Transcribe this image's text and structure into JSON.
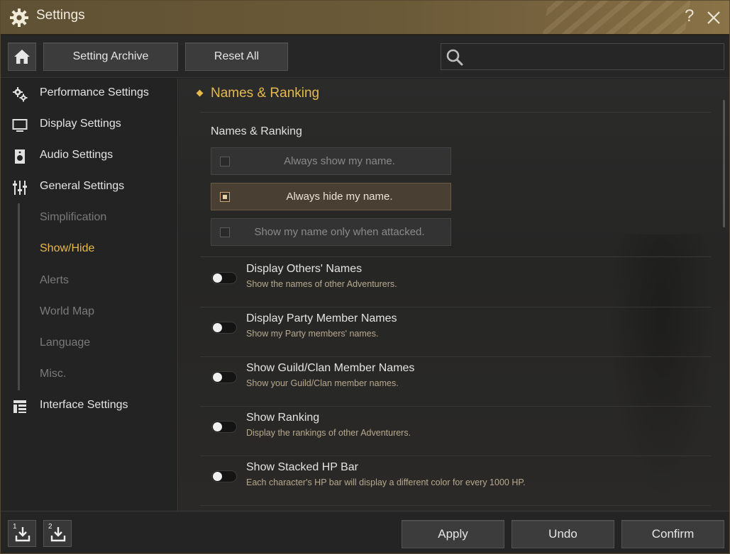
{
  "window": {
    "title": "Settings",
    "help_glyph": "?",
    "close_glyph": "close"
  },
  "toolbar": {
    "archive_label": "Setting Archive",
    "reset_label": "Reset All",
    "search_value": "",
    "search_placeholder": ""
  },
  "sidebar": {
    "items": [
      {
        "label": "Performance Settings",
        "icon": "gears-icon"
      },
      {
        "label": "Display Settings",
        "icon": "monitor-icon"
      },
      {
        "label": "Audio Settings",
        "icon": "speaker-icon"
      },
      {
        "label": "General Settings",
        "icon": "sliders-icon"
      },
      {
        "label": "Interface Settings",
        "icon": "layout-icon"
      }
    ],
    "sub_items": [
      {
        "label": "Simplification",
        "active": false
      },
      {
        "label": "Show/Hide",
        "active": true
      },
      {
        "label": "Alerts",
        "active": false
      },
      {
        "label": "World Map",
        "active": false
      },
      {
        "label": "Language",
        "active": false
      },
      {
        "label": "Misc.",
        "active": false
      }
    ]
  },
  "main": {
    "section_title": "Names & Ranking",
    "group_label": "Names & Ranking",
    "name_options": [
      {
        "label": "Always show my name.",
        "selected": false
      },
      {
        "label": "Always hide my name.",
        "selected": true
      },
      {
        "label": "Show my name only when attacked.",
        "selected": false
      }
    ],
    "toggles": [
      {
        "title": "Display Others' Names",
        "desc": "Show the names of other Adventurers.",
        "on": false
      },
      {
        "title": "Display Party Member Names",
        "desc": "Show my Party members' names.",
        "on": false
      },
      {
        "title": "Show Guild/Clan Member Names",
        "desc": "Show your Guild/Clan member names.",
        "on": false
      },
      {
        "title": "Show Ranking",
        "desc": "Display the rankings of other Adventurers.",
        "on": false
      },
      {
        "title": "Show Stacked HP Bar",
        "desc": "Each character's HP bar will display a different color for every 1000 HP.",
        "on": false
      }
    ]
  },
  "footer": {
    "slot1_num": "1",
    "slot2_num": "2",
    "apply_label": "Apply",
    "undo_label": "Undo",
    "confirm_label": "Confirm"
  },
  "colors": {
    "accent": "#e6b94e",
    "titlebar": "#6b5a38",
    "selected_option": "#4a3f33"
  }
}
